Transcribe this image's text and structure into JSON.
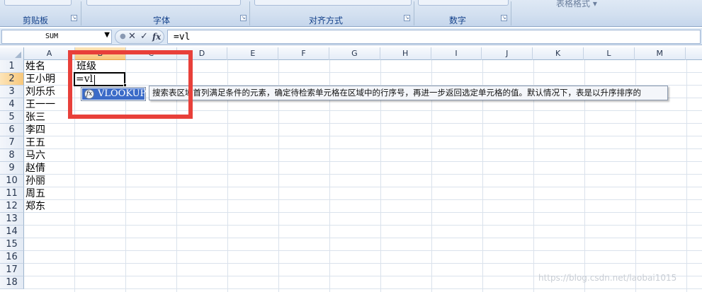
{
  "ribbon": {
    "groups": [
      {
        "label": "剪贴板"
      },
      {
        "label": "字体"
      },
      {
        "label": "对齐方式"
      },
      {
        "label": "数字"
      },
      {
        "label": "表格格式 ▾"
      }
    ]
  },
  "formula_bar": {
    "name_box": "SUM",
    "cancel_label": "✕",
    "enter_label": "✓",
    "fx_label": "fx",
    "formula": "=vl"
  },
  "columns": [
    "A",
    "B",
    "C",
    "D",
    "E",
    "F",
    "G",
    "H",
    "I",
    "J",
    "K",
    "L",
    "M"
  ],
  "active_column": "B",
  "rows": [
    "1",
    "2",
    "3",
    "4",
    "5",
    "6",
    "7",
    "8",
    "9",
    "10",
    "11",
    "12",
    "13",
    "14",
    "15",
    "16",
    "17",
    "18"
  ],
  "active_row": "2",
  "cells": {
    "A": [
      "姓名",
      "王小明",
      "刘乐乐",
      "王一一",
      "张三",
      "李四",
      "王五",
      "马六",
      "赵倩",
      "孙丽",
      "周五",
      "郑东"
    ],
    "B1": "班级",
    "B2": "=vl"
  },
  "autocomplete": {
    "item": "VLOOKUP",
    "icon": "fx-function-icon",
    "tooltip": "搜索表区域首列满足条件的元素，确定待检索单元格在区域中的行序号，再进一步返回选定单元格的值。默认情况下，表是以升序排序的"
  },
  "watermark": "https://blog.csdn.net/laobai1015"
}
